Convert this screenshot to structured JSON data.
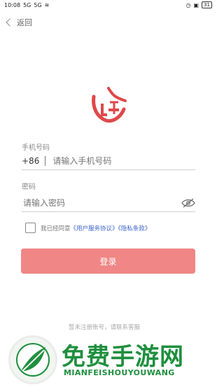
{
  "status_bar": {
    "time": "10:08",
    "signal_1": "5G",
    "signal_2": "5G",
    "battery": "31"
  },
  "header": {
    "back_label": "返回"
  },
  "phone": {
    "label": "手机号码",
    "country_code": "+86",
    "placeholder": "请输入手机号码"
  },
  "password": {
    "label": "密码",
    "placeholder": "请输入密码"
  },
  "agreement": {
    "prefix": "我已经同意",
    "service_link": "《用户服务协议》",
    "privacy_link": "《隐私条款》"
  },
  "login_button": "登录",
  "register_tip": "暂未注册账号，请联系客服",
  "watermark": {
    "title": "免费手游网",
    "subtitle": "MIANFEISHOUYOUWANG"
  },
  "colors": {
    "button": "#f08686",
    "link": "#3b64c8",
    "logo": "#e0484a",
    "watermark": "#1f8f3e"
  }
}
